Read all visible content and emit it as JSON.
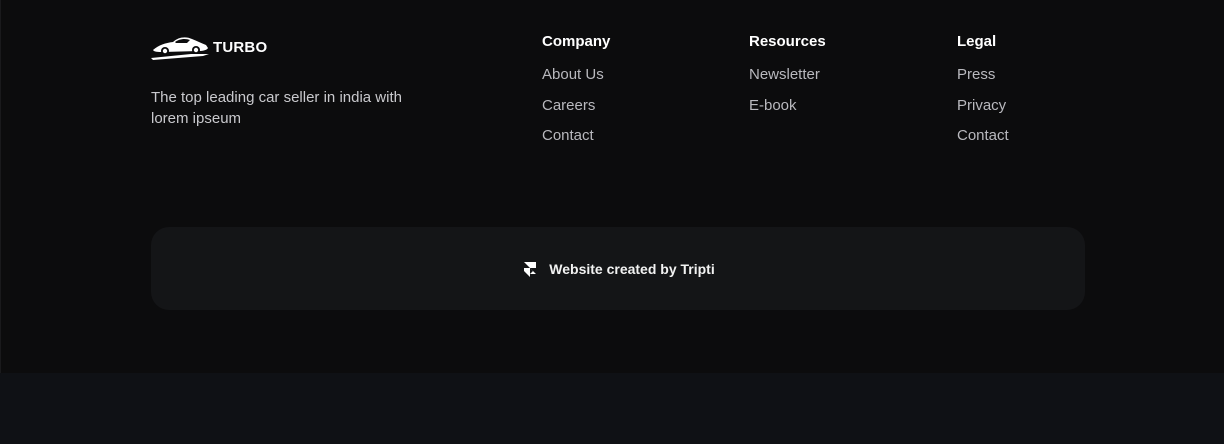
{
  "brand": {
    "name": "TURBO",
    "tagline": "The top leading car seller in india with lorem ipseum",
    "logo_icon": "sports-car-icon"
  },
  "columns": [
    {
      "title": "Company",
      "links": [
        "About Us",
        "Careers",
        "Contact"
      ]
    },
    {
      "title": "Resources",
      "links": [
        "Newsletter",
        "E-book"
      ]
    },
    {
      "title": "Legal",
      "links": [
        "Press",
        "Privacy",
        "Contact"
      ]
    }
  ],
  "credit": {
    "text": "Website created by Tripti",
    "icon": "framer-logo-icon"
  },
  "colors": {
    "footer_bg": "#0c0c0d",
    "page_bg": "#0f1115",
    "credit_bar_bg": "#141517",
    "heading": "#ffffff",
    "link": "#b9b9be"
  }
}
